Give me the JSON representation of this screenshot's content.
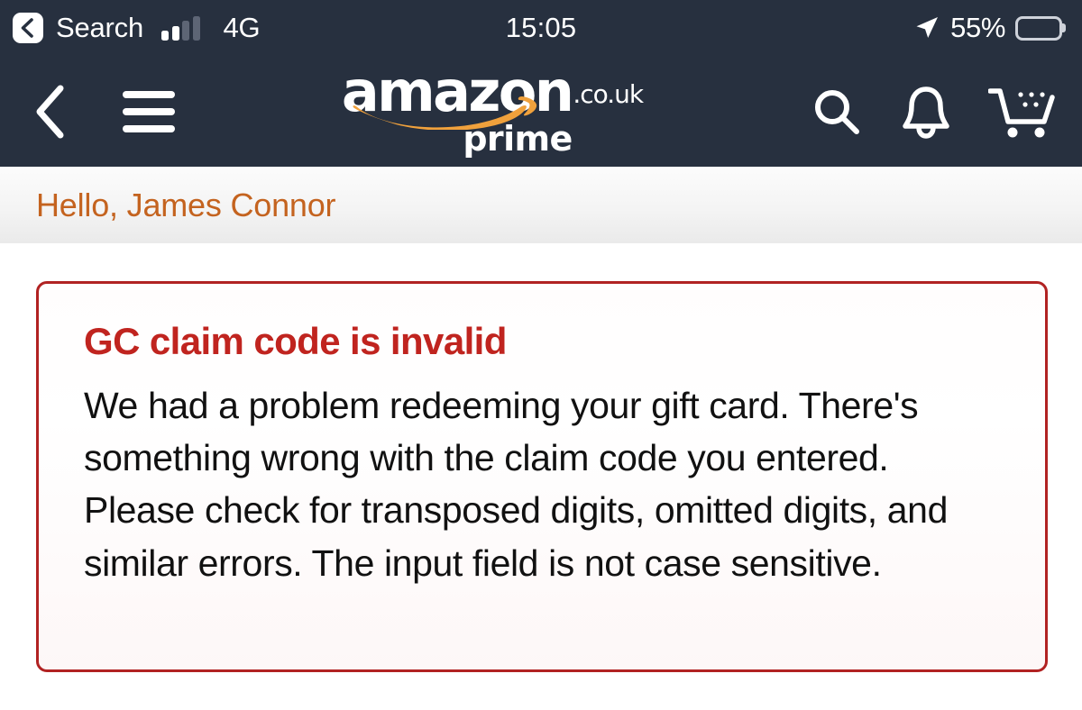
{
  "status_bar": {
    "back_chip_icon": "chevron-left-icon",
    "back_label": "Search",
    "signal_icon": "cellular-signal-icon",
    "signal_bars_active": 2,
    "signal_bars_total": 4,
    "carrier": "4G",
    "time": "15:05",
    "location_icon": "location-arrow-icon",
    "battery_percent": "55%",
    "battery_level": 55,
    "battery_icon": "battery-icon"
  },
  "nav_bar": {
    "background_color": "#27303F",
    "back_icon": "chevron-left-icon",
    "menu_icon": "hamburger-menu-icon",
    "logo": {
      "word": "amazon",
      "tld": ".co.uk",
      "subtitle": "prime",
      "smile_icon": "amazon-smile-arrow-icon",
      "smile_color": "#F0A13C"
    },
    "search_icon": "search-icon",
    "notifications_icon": "bell-icon",
    "cart_icon": "shopping-cart-icon"
  },
  "greeting": {
    "text": "Hello, James Connor",
    "color": "#c4631f"
  },
  "alert": {
    "title": "GC claim code is invalid",
    "body": "We had a problem redeeming your gift card. There's something wrong with the claim code you entered. Please check for transposed digits, omitted digits, and similar errors. The input field is not case sensitive.",
    "border_color": "#b12222",
    "title_color": "#c0241f"
  }
}
